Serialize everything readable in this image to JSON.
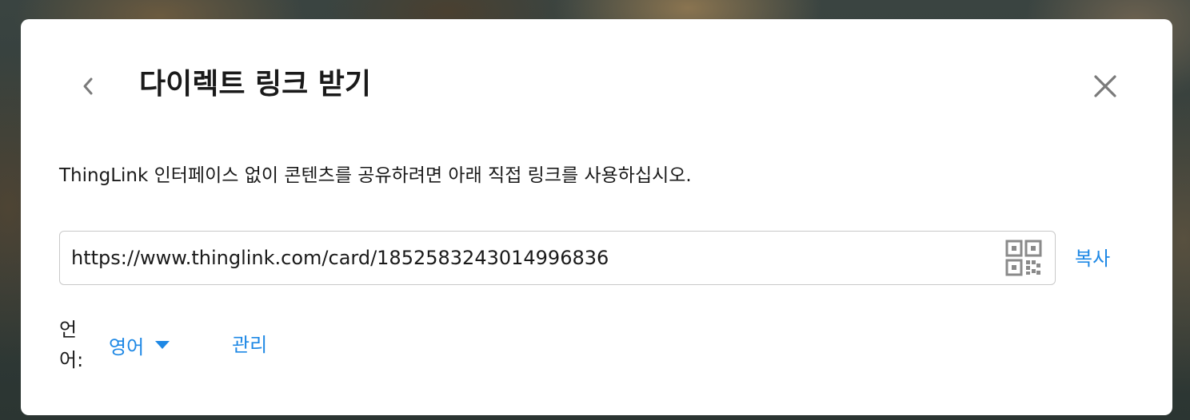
{
  "dialog": {
    "title": "다이렉트 링크 받기",
    "description": "ThingLink 인터페이스 없이 콘텐츠를 공유하려면 아래 직접 링크를 사용하십시오.",
    "back_icon": "chevron-left-icon",
    "close_icon": "close-icon"
  },
  "link": {
    "value": "https://www.thinglink.com/card/1852583243014996836",
    "qr_icon": "qr-code-icon",
    "copy_label": "복사"
  },
  "language": {
    "label_line1": "언",
    "label_line2": "어:",
    "selected": "영어",
    "manage_label": "관리"
  },
  "colors": {
    "accent": "#1e88e5",
    "text": "#1a1a1a",
    "icon_gray": "#7a7a7a"
  }
}
